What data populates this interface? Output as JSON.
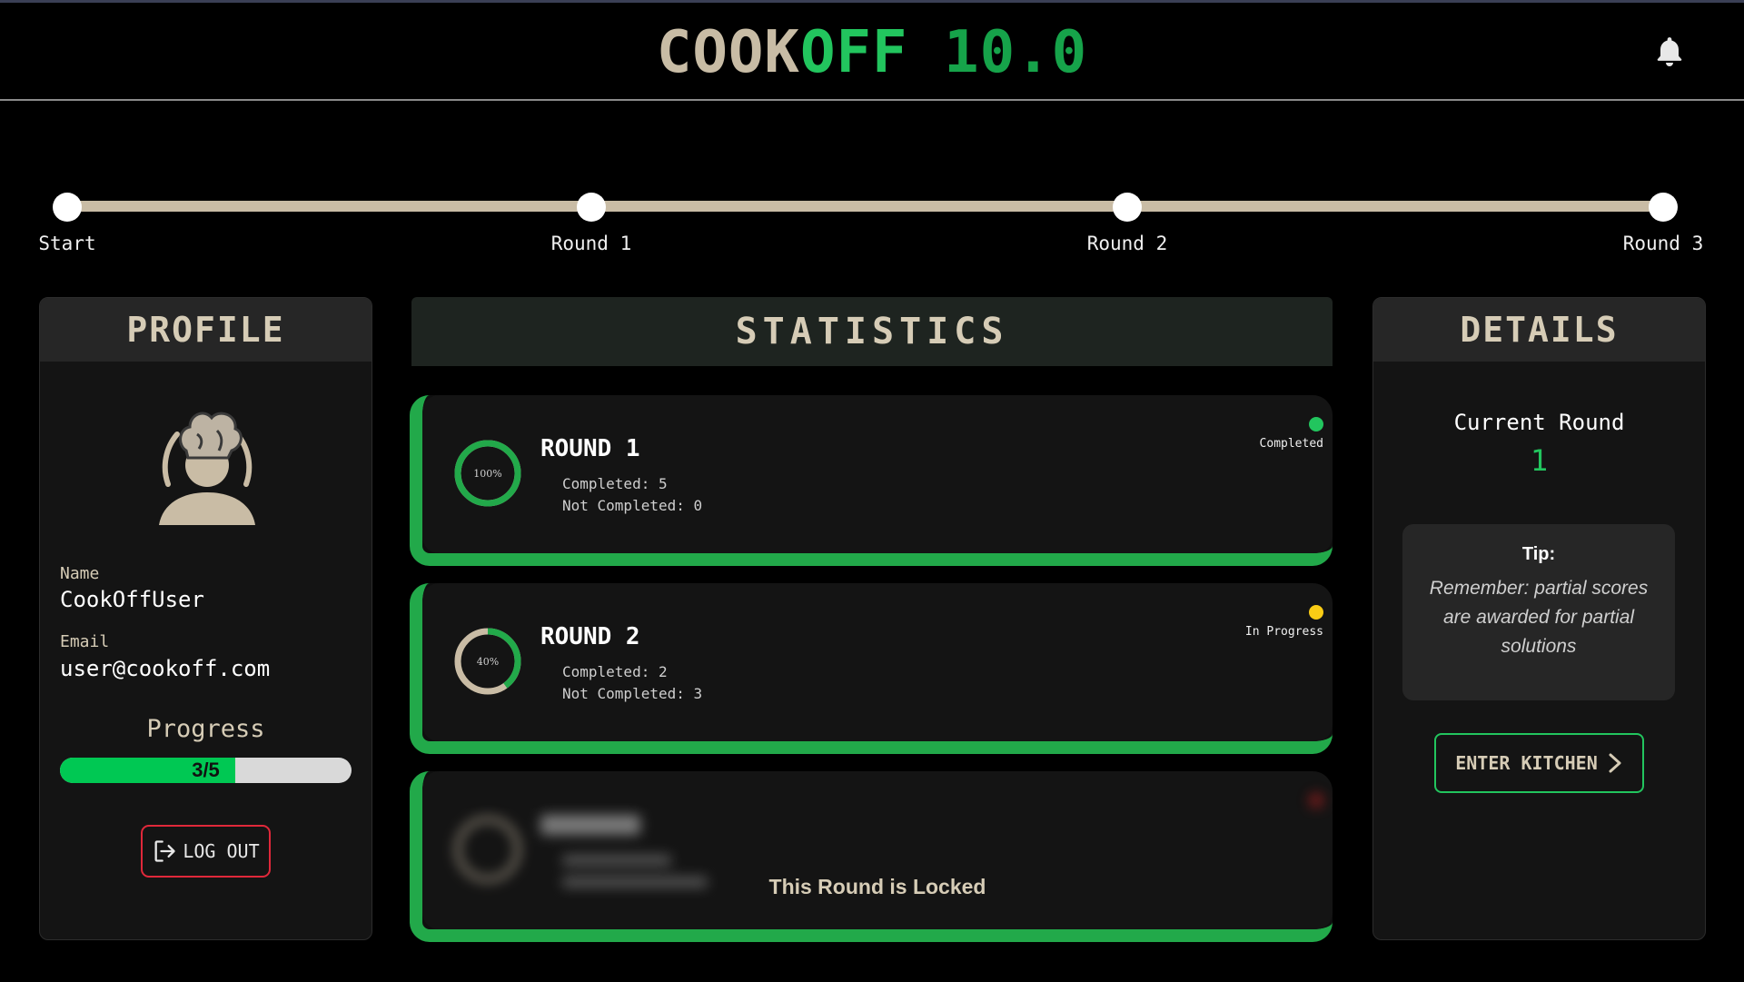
{
  "header": {
    "brand_part1": "COOK",
    "brand_part2": "OFF",
    "brand_part3": " 10.0",
    "notification_icon": "bell-icon"
  },
  "timeline": {
    "steps": [
      {
        "label": "Start"
      },
      {
        "label": "Round 1"
      },
      {
        "label": "Round 2"
      },
      {
        "label": "Round 3"
      }
    ]
  },
  "profile": {
    "title": "PROFILE",
    "avatar_icon": "chef-avatar-icon",
    "name_label": "Name",
    "name_value": "CookOffUser",
    "email_label": "Email",
    "email_value": "user@cookoff.com",
    "progress_title": "Progress",
    "progress_text": "3/5",
    "progress_fraction": 0.6,
    "logout_label": "LOG OUT",
    "logout_icon": "logout-icon"
  },
  "statistics": {
    "title": "STATISTICS",
    "rounds": [
      {
        "title": "ROUND 1",
        "percent_label": "100%",
        "percent": 100,
        "completed_text": "Completed: 5",
        "not_completed_text": "Not Completed: 0",
        "status": "Completed",
        "status_color": "#22c55e"
      },
      {
        "title": "ROUND 2",
        "percent_label": "40%",
        "percent": 40,
        "completed_text": "Completed: 2",
        "not_completed_text": "Not Completed: 3",
        "status": "In Progress",
        "status_color": "#facc15"
      },
      {
        "locked_message": "This Round is Locked",
        "status_color": "#dc2626"
      }
    ]
  },
  "details": {
    "title": "DETAILS",
    "current_round_label": "Current Round",
    "current_round_value": "1",
    "tip_title": "Tip:",
    "tip_text": "Remember: partial scores are awarded for partial solutions",
    "enter_label": "ENTER KITCHEN",
    "enter_icon": "chevron-right-icon"
  },
  "colors": {
    "accent_green": "#22c55e",
    "beige": "#d6ccb6",
    "danger_red": "#e0283a"
  }
}
